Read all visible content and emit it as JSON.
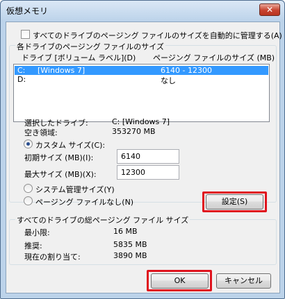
{
  "window": {
    "title": "仮想メモリ",
    "close_label": "✕"
  },
  "auto_manage": {
    "label": "すべてのドライブのページング ファイルのサイズを自動的に管理する(A)"
  },
  "drives_group": {
    "title": "各ドライブのページング ファイルのサイズ"
  },
  "list": {
    "header_drive": "ドライブ [ボリューム ラベル](D)",
    "header_size": "ページング ファイルのサイズ (MB)",
    "rows": [
      {
        "drive": "C:",
        "label": "[Windows 7]",
        "size": "6140 - 12300"
      },
      {
        "drive": "D:",
        "label": "",
        "size": "なし"
      }
    ]
  },
  "selected_drive": {
    "label": "選択したドライブ:",
    "value": "C:  [Windows 7]"
  },
  "free_space": {
    "label": "空き領域:",
    "value": "353270 MB"
  },
  "custom_size": {
    "label": "カスタム サイズ(C):",
    "initial_label": "初期サイズ (MB)(I):",
    "initial_value": "6140",
    "max_label": "最大サイズ (MB)(X):",
    "max_value": "12300"
  },
  "system_managed": {
    "label": "システム管理サイズ(Y)"
  },
  "no_paging": {
    "label": "ページング ファイルなし(N)"
  },
  "set_button": {
    "label": "設定(S)"
  },
  "total_group": {
    "title": "すべてのドライブの総ページング ファイル サイズ",
    "min_label": "最小限:",
    "min_value": "16 MB",
    "recommended_label": "推奨:",
    "recommended_value": "5835 MB",
    "current_label": "現在の割り当て:",
    "current_value": "3890 MB"
  },
  "ok_button": {
    "label": "OK"
  },
  "cancel_button": {
    "label": "キャンセル"
  },
  "colors": {
    "highlight": "#e0141e",
    "selection": "#3399ff"
  }
}
